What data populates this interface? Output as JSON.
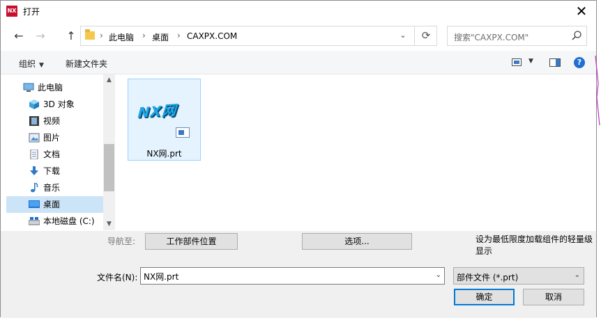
{
  "window": {
    "title": "打开",
    "app_icon_text": "NX",
    "close_glyph": "✕"
  },
  "navigation": {
    "back_glyph": "←",
    "forward_glyph": "→",
    "up_glyph": "↑",
    "breadcrumb": [
      "此电脑",
      "桌面",
      "CAXPX.COM"
    ],
    "breadcrumb_separator": "›",
    "refresh_glyph": "⟳",
    "search_placeholder": "搜索\"CAXPX.COM\""
  },
  "toolbar": {
    "organize_label": "组织",
    "new_folder_label": "新建文件夹",
    "help_glyph": "?"
  },
  "sidebar": {
    "items": [
      {
        "label": "此电脑",
        "icon": "computer-icon",
        "selected": false
      },
      {
        "label": "3D 对象",
        "icon": "cube-icon",
        "selected": false
      },
      {
        "label": "视频",
        "icon": "video-icon",
        "selected": false
      },
      {
        "label": "图片",
        "icon": "picture-icon",
        "selected": false
      },
      {
        "label": "文档",
        "icon": "document-icon",
        "selected": false
      },
      {
        "label": "下载",
        "icon": "download-icon",
        "selected": false
      },
      {
        "label": "音乐",
        "icon": "music-icon",
        "selected": false
      },
      {
        "label": "桌面",
        "icon": "desktop-icon",
        "selected": true
      },
      {
        "label": "本地磁盘 (C:)",
        "icon": "drive-icon",
        "selected": false
      }
    ]
  },
  "files": [
    {
      "name": "NX网.prt",
      "thumbnail_text": "NX网"
    }
  ],
  "bottom": {
    "navigate_to_label": "导航至:",
    "work_part_location_button": "工作部件位置",
    "options_button": "选项...",
    "lightweight_text": "设为最低限度加载组件的轻量级显示",
    "filename_label": "文件名(N):",
    "filename_value": "NX网.prt",
    "filetype_value": "部件文件 (*.prt)",
    "ok_button": "确定",
    "cancel_button": "取消"
  },
  "colors": {
    "selection": "#cce4f7",
    "accent": "#0078d7",
    "tile_border": "#99d1ff",
    "nx_logo": "#1ea6e6"
  }
}
